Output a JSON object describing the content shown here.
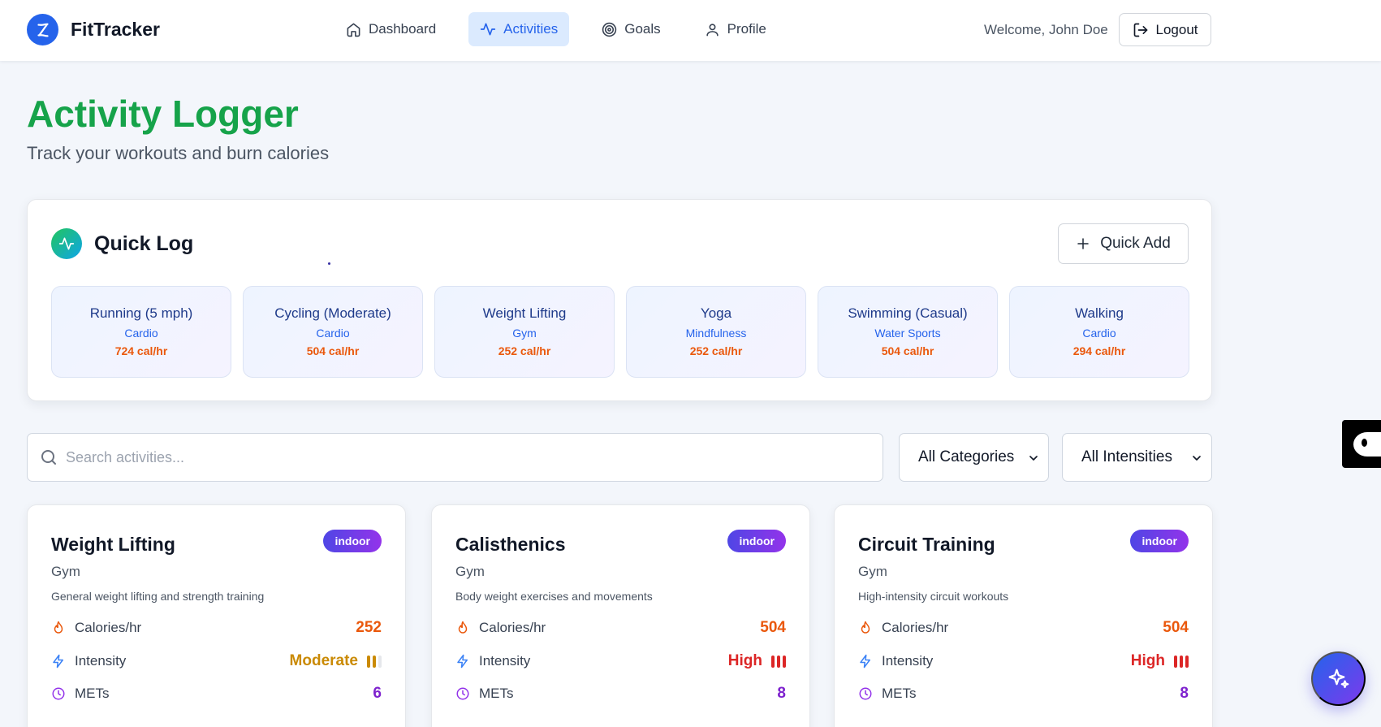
{
  "app": {
    "name": "FitTracker"
  },
  "nav": {
    "items": [
      {
        "label": "Dashboard",
        "icon": "home-icon",
        "active": false
      },
      {
        "label": "Activities",
        "icon": "activity-icon",
        "active": true
      },
      {
        "label": "Goals",
        "icon": "target-icon",
        "active": false
      },
      {
        "label": "Profile",
        "icon": "user-icon",
        "active": false
      }
    ]
  },
  "header": {
    "welcome": "Welcome, John Doe",
    "logout_label": "Logout"
  },
  "page": {
    "title": "Activity Logger",
    "subtitle": "Track your workouts and burn calories"
  },
  "quick_log": {
    "title": "Quick Log",
    "add_label": "Quick Add",
    "items": [
      {
        "name": "Running (5 mph)",
        "category": "Cardio",
        "calories": "724 cal/hr"
      },
      {
        "name": "Cycling (Moderate)",
        "category": "Cardio",
        "calories": "504 cal/hr"
      },
      {
        "name": "Weight Lifting",
        "category": "Gym",
        "calories": "252 cal/hr"
      },
      {
        "name": "Yoga",
        "category": "Mindfulness",
        "calories": "252 cal/hr"
      },
      {
        "name": "Swimming (Casual)",
        "category": "Water Sports",
        "calories": "504 cal/hr"
      },
      {
        "name": "Walking",
        "category": "Cardio",
        "calories": "294 cal/hr"
      }
    ]
  },
  "filters": {
    "search_placeholder": "Search activities...",
    "category_selected": "All Categories",
    "intensity_selected": "All Intensities"
  },
  "stat_labels": {
    "calories": "Calories/hr",
    "intensity": "Intensity",
    "mets": "METs"
  },
  "activities": [
    {
      "name": "Weight Lifting",
      "badge": "indoor",
      "category": "Gym",
      "description": "General weight lifting and strength training",
      "calories": "252",
      "intensity": "Moderate",
      "intensity_level": 2,
      "mets": "6"
    },
    {
      "name": "Calisthenics",
      "badge": "indoor",
      "category": "Gym",
      "description": "Body weight exercises and movements",
      "calories": "504",
      "intensity": "High",
      "intensity_level": 3,
      "mets": "8"
    },
    {
      "name": "Circuit Training",
      "badge": "indoor",
      "category": "Gym",
      "description": "High-intensity circuit workouts",
      "calories": "504",
      "intensity": "High",
      "intensity_level": 3,
      "mets": "8"
    }
  ],
  "colors": {
    "brand": "#2563eb",
    "title_green": "#16a34a",
    "calories_orange": "#ea580c",
    "intensity_moderate": "#ca8a04",
    "intensity_high": "#dc2626",
    "mets_purple": "#7e22ce"
  }
}
